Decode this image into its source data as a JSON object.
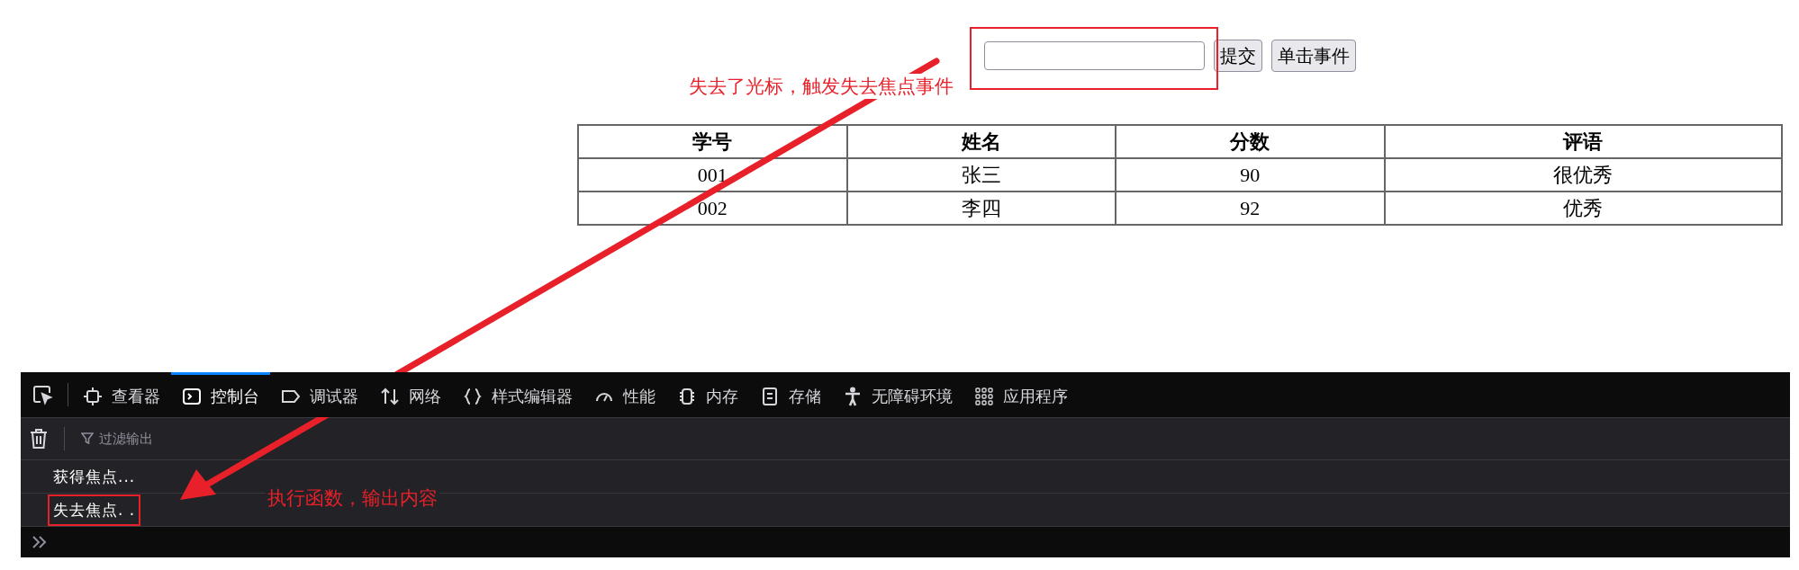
{
  "form": {
    "buttons": [
      "提交",
      "单击事件"
    ]
  },
  "annotations": [
    {
      "text": "失去了光标，触发失去焦点事件"
    },
    {
      "text": "执行函数，输出内容"
    }
  ],
  "table": {
    "columns": [
      "学号",
      "姓名",
      "分数",
      "评语"
    ],
    "rows": [
      [
        "001",
        "张三",
        "90",
        "很优秀"
      ],
      [
        "002",
        "李四",
        "92",
        "优秀"
      ]
    ]
  },
  "devtools": {
    "tabs": [
      {
        "label": "查看器",
        "selected": false
      },
      {
        "label": "控制台",
        "selected": true
      },
      {
        "label": "调试器",
        "selected": false
      },
      {
        "label": "网络",
        "selected": false
      },
      {
        "label": "样式编辑器",
        "selected": false
      },
      {
        "label": "性能",
        "selected": false
      },
      {
        "label": "内存",
        "selected": false
      },
      {
        "label": "存储",
        "selected": false
      },
      {
        "label": "无障碍环境",
        "selected": false
      },
      {
        "label": "应用程序",
        "selected": false
      }
    ],
    "filter": {
      "placeholder": "过滤输出"
    },
    "messages": [
      {
        "text": "获得焦点...",
        "highlighted": false
      },
      {
        "text": "失去焦点. .",
        "highlighted": true
      }
    ]
  }
}
